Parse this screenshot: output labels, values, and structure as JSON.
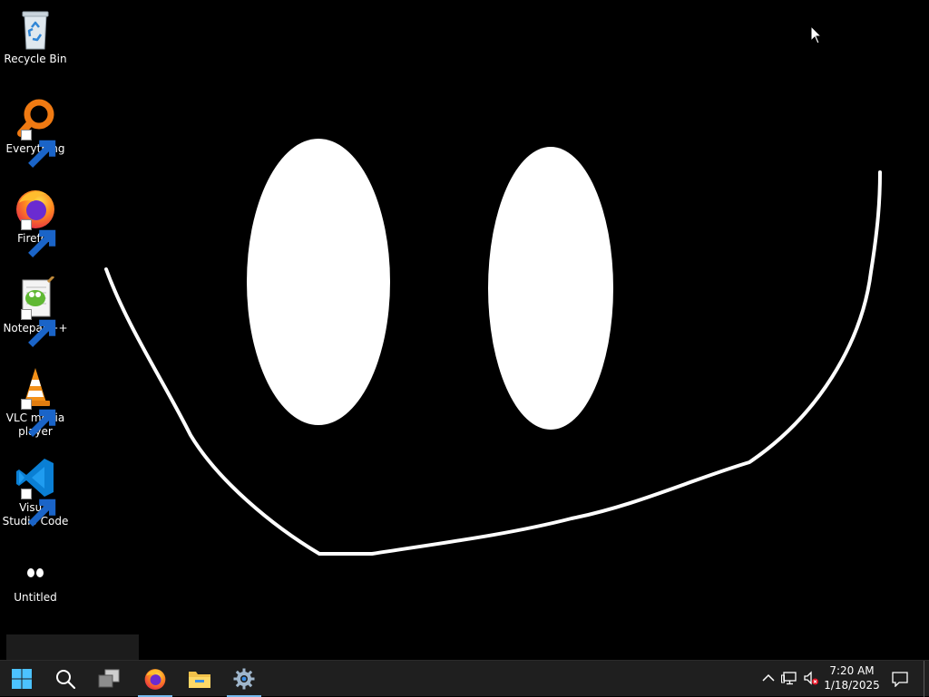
{
  "desktop": {
    "icons": [
      {
        "label": "Recycle Bin",
        "icon": "recycle-bin-icon"
      },
      {
        "label": "Everything",
        "icon": "everything-search-icon"
      },
      {
        "label": "Firefox",
        "icon": "firefox-icon"
      },
      {
        "label": "Notepad++",
        "icon": "notepad-plus-plus-icon"
      },
      {
        "label": "VLC media player",
        "icon": "vlc-icon"
      },
      {
        "label": "Visual Studio Code",
        "icon": "vscode-icon"
      },
      {
        "label": "Untitled",
        "icon": "untitled-eyes-icon"
      }
    ],
    "background_color": "#000000",
    "drawing_color": "#ffffff"
  },
  "taskbar": {
    "pinned": [
      {
        "name": "start",
        "icon": "windows-start-icon"
      },
      {
        "name": "search",
        "icon": "search-icon"
      },
      {
        "name": "task-view",
        "icon": "task-view-icon"
      },
      {
        "name": "firefox",
        "icon": "firefox-icon",
        "active": true
      },
      {
        "name": "file-explorer",
        "icon": "folder-icon",
        "active": false
      },
      {
        "name": "settings",
        "icon": "gear-icon",
        "active": true
      }
    ],
    "tray": {
      "time": "7:20 AM",
      "date": "1/18/2025"
    },
    "accent": "#76b9ed"
  }
}
